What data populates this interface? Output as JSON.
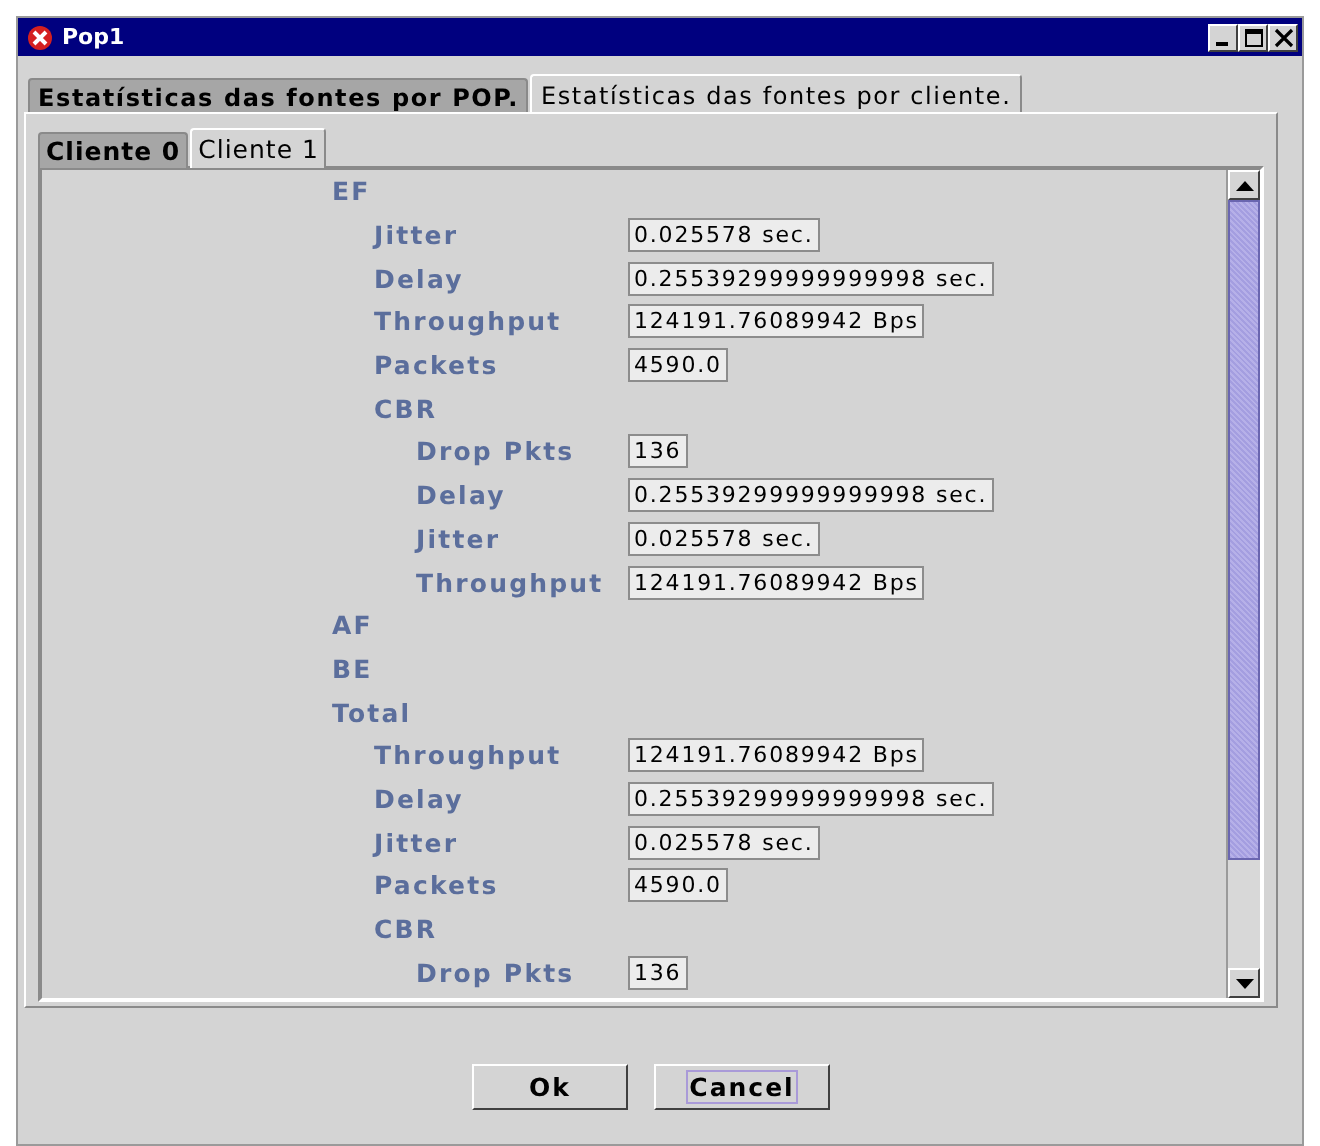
{
  "window": {
    "title": "Pop1"
  },
  "tabs": [
    {
      "label": "Estatísticas das fontes por POP.",
      "selected": false
    },
    {
      "label": "Estatísticas das fontes por cliente.",
      "selected": true
    }
  ],
  "client_tabs": [
    {
      "label": "Cliente 0",
      "selected": false
    },
    {
      "label": "Cliente 1",
      "selected": true
    }
  ],
  "tree": [
    {
      "label": "EF",
      "children": [
        {
          "label": "Jitter",
          "value": "0.025578 sec."
        },
        {
          "label": "Delay",
          "value": "0.25539299999999998 sec."
        },
        {
          "label": "Throughput",
          "value": "124191.76089942 Bps"
        },
        {
          "label": "Packets",
          "value": "4590.0"
        },
        {
          "label": "CBR",
          "children": [
            {
              "label": "Drop Pkts",
              "value": "136"
            },
            {
              "label": "Delay",
              "value": "0.25539299999999998 sec."
            },
            {
              "label": "Jitter",
              "value": "0.025578 sec."
            },
            {
              "label": "Throughput",
              "value": "124191.76089942 Bps"
            }
          ]
        }
      ]
    },
    {
      "label": "AF"
    },
    {
      "label": "BE"
    },
    {
      "label": "Total",
      "children": [
        {
          "label": "Throughput",
          "value": "124191.76089942 Bps"
        },
        {
          "label": "Delay",
          "value": "0.25539299999999998 sec."
        },
        {
          "label": "Jitter",
          "value": "0.025578 sec."
        },
        {
          "label": "Packets",
          "value": "4590.0"
        },
        {
          "label": "CBR",
          "children": [
            {
              "label": "Drop Pkts",
              "value": "136"
            }
          ]
        }
      ]
    }
  ],
  "buttons": [
    {
      "label": "Ok",
      "focused": false
    },
    {
      "label": "Cancel",
      "focused": true
    }
  ]
}
